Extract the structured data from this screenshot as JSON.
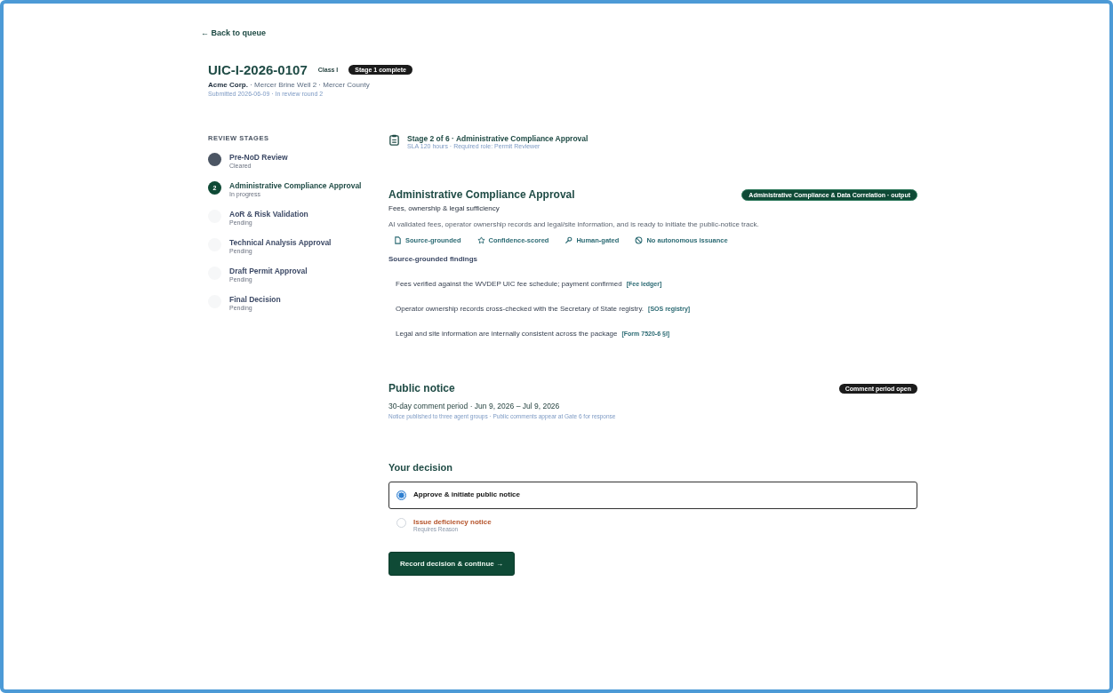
{
  "back_link": {
    "arrow": "←",
    "label": "Back to queue"
  },
  "header": {
    "case_id": "UIC-I-2026-0107",
    "class_label": "Class I",
    "status_badge": "Stage 1 complete",
    "operator": "Acme Corp.",
    "subtitle": "· Mercer Brine Well 2 · Mercer County",
    "meta": "Submitted 2026-06-09 · In review round 2"
  },
  "sidebar": {
    "heading": "REVIEW STAGES",
    "stages": [
      {
        "title": "Pre-NoD Review",
        "status_text": "Cleared",
        "kind": "cleared",
        "selected": false
      },
      {
        "number": "2",
        "title": "Administrative Compliance Approval",
        "status_text": "In progress",
        "kind": "current",
        "selected": true
      },
      {
        "title": "AoR & Risk Validation",
        "status_text": "Pending",
        "kind": "pending",
        "selected": false
      },
      {
        "title": "Technical Analysis Approval",
        "status_text": "Pending",
        "kind": "pending",
        "selected": false
      },
      {
        "title": "Draft Permit Approval",
        "status_text": "Pending",
        "kind": "pending",
        "selected": false
      },
      {
        "title": "Final Decision",
        "status_text": "Pending",
        "kind": "pending",
        "selected": false
      }
    ]
  },
  "stage_header": {
    "title": "Stage 2 of 6 · Administrative Compliance Approval",
    "subtitle": "SLA 120 hours · Required role: Permit Reviewer"
  },
  "review": {
    "title": "Administrative Compliance Approval",
    "badge": "Administrative Compliance & Data Correlation · output",
    "subtitle": "Fees, ownership & legal sufficiency",
    "summary": "AI validated fees, operator ownership records and legal/site information, and is ready to initiate the public-notice track.",
    "traits": [
      {
        "kind": "source",
        "label": "Source-grounded"
      },
      {
        "kind": "confidence",
        "label": "Confidence-scored"
      },
      {
        "kind": "human",
        "label": "Human-gated"
      },
      {
        "kind": "none",
        "label": "No autonomous issuance"
      }
    ],
    "findings_heading": "Source-grounded findings",
    "findings": [
      {
        "text": "Fees verified against the WVDEP UIC fee schedule; payment confirmed",
        "source": "[Fee ledger]"
      },
      {
        "text": "Operator ownership records cross-checked with the Secretary of State registry.",
        "source": "[SOS registry]"
      },
      {
        "text": "Legal and site information are internally consistent across the package",
        "source": "[Form 7520-6 §I]"
      }
    ]
  },
  "public_notice": {
    "title": "Public notice",
    "badge": "Comment period open",
    "period": "30-day comment period · Jun 9, 2026 – Jul 9, 2026",
    "note": "Notice published to three agent groups · Public comments appear at Gate 6 for response"
  },
  "decision": {
    "title": "Your decision",
    "options": [
      {
        "kind": "approve",
        "label": "Approve & initiate public notice",
        "selected": true
      },
      {
        "kind": "deficiency",
        "label": "Issue deficiency notice",
        "hint": "Requires Reason",
        "selected": false
      }
    ],
    "submit": {
      "label": "Record decision & continue",
      "arrow": "→"
    }
  }
}
